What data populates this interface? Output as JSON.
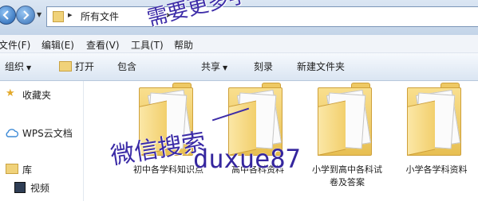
{
  "address": {
    "path": "所有文件"
  },
  "menubar": {
    "file": "文件(F)",
    "edit": "编辑(E)",
    "view": "查看(V)",
    "tools": "工具(T)",
    "help": "帮助"
  },
  "toolbar": {
    "organize": "组织",
    "open": "打开",
    "include": "包含",
    "share": "共享",
    "burn": "刻录",
    "new_folder": "新建文件夹"
  },
  "nav": {
    "favorites": "收藏夹",
    "wps": "WPS云文档",
    "library": "库",
    "video": "视频"
  },
  "files": [
    {
      "name": "初中各学科知识点"
    },
    {
      "name": "高中各科资料"
    },
    {
      "name": "小学到高中各科试卷及答案"
    },
    {
      "name": "小学各学科资料"
    }
  ],
  "watermark": {
    "line1": "需要更多学习资料",
    "line2": "微信搜索",
    "line3": "duxue87"
  }
}
